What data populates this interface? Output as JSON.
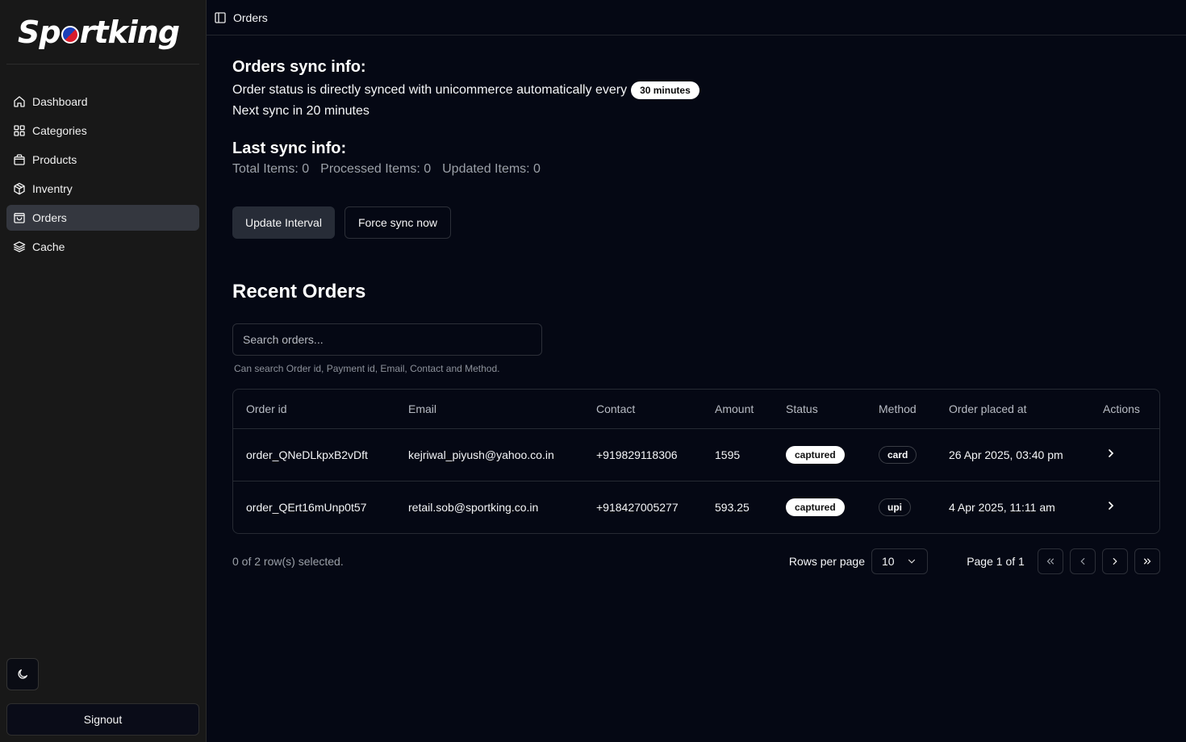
{
  "sidebar": {
    "brand": "Sportking",
    "items": [
      {
        "label": "Dashboard",
        "icon": "home-icon"
      },
      {
        "label": "Categories",
        "icon": "grid-icon"
      },
      {
        "label": "Products",
        "icon": "shopping-bag-icon"
      },
      {
        "label": "Inventry",
        "icon": "package-icon"
      },
      {
        "label": "Orders",
        "icon": "shopping-bag-icon",
        "active": true
      },
      {
        "label": "Cache",
        "icon": "layers-icon"
      }
    ],
    "theme_icon": "moon-icon",
    "signout_label": "Signout"
  },
  "header": {
    "title": "Orders",
    "toggle_icon": "sidebar-panel-icon"
  },
  "sync": {
    "title": "Orders sync info:",
    "description": "Order status is directly synced with unicommerce automatically every",
    "interval": "30 minutes",
    "next_sync": "Next sync in 20 minutes"
  },
  "last_sync": {
    "title": "Last sync info:",
    "total": "Total Items: 0",
    "processed": "Processed Items: 0",
    "updated": "Updated Items: 0"
  },
  "actions": {
    "update_interval": "Update Interval",
    "force_sync": "Force sync now"
  },
  "recent": {
    "title": "Recent Orders",
    "search_placeholder": "Search orders...",
    "search_hint": "Can search Order id, Payment id, Email, Contact and Method.",
    "columns": [
      "Order id",
      "Email",
      "Contact",
      "Amount",
      "Status",
      "Method",
      "Order placed at",
      "Actions"
    ],
    "rows": [
      {
        "order_id": "order_QNeDLkpxB2vDft",
        "email": "kejriwal_piyush@yahoo.co.in",
        "contact": "+919829118306",
        "amount": "1595",
        "status": "captured",
        "method": "card",
        "placed_at": "26 Apr 2025, 03:40 pm"
      },
      {
        "order_id": "order_QErt16mUnp0t57",
        "email": "retail.sob@sportking.co.in",
        "contact": "+918427005277",
        "amount": "593.25",
        "status": "captured",
        "method": "upi",
        "placed_at": "4 Apr 2025, 11:11 am"
      }
    ]
  },
  "pagination": {
    "selected_text": "0 of 2 row(s) selected.",
    "rows_per_page_label": "Rows per page",
    "rows_per_page": "10",
    "page_text": "Page 1 of 1"
  },
  "colors": {
    "background": "#050814",
    "sidebar": "#181818",
    "active_item": "#34373f",
    "primary_button": "#272c37"
  }
}
